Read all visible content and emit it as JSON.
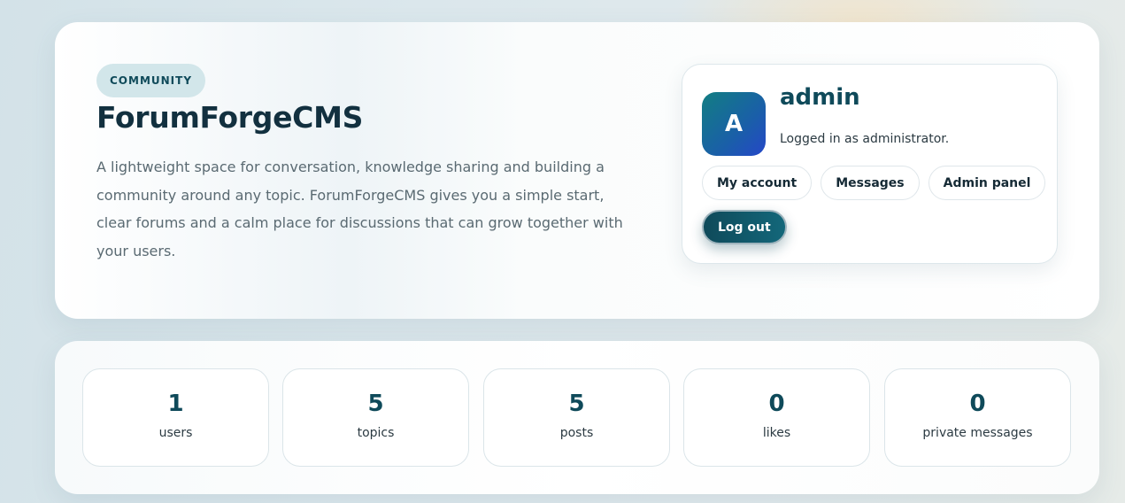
{
  "hero": {
    "badge": "COMMUNITY",
    "title": "ForumForgeCMS",
    "description": "A lightweight space for conversation, knowledge sharing and building a community around any topic. ForumForgeCMS gives you a simple start, clear forums and a calm place for discussions that can grow together with your users."
  },
  "user": {
    "avatar_letter": "A",
    "name": "admin",
    "role_text": "Logged in as administrator.",
    "buttons": {
      "account": "My account",
      "messages": "Messages",
      "admin": "Admin panel",
      "logout": "Log out"
    }
  },
  "stats": [
    {
      "value": "1",
      "label": "users"
    },
    {
      "value": "5",
      "label": "topics"
    },
    {
      "value": "5",
      "label": "posts"
    },
    {
      "value": "0",
      "label": "likes"
    },
    {
      "value": "0",
      "label": "private messages"
    }
  ],
  "colors": {
    "accent": "#0f4a5a",
    "title": "#12303f",
    "badge_bg": "#d2e6ea"
  }
}
